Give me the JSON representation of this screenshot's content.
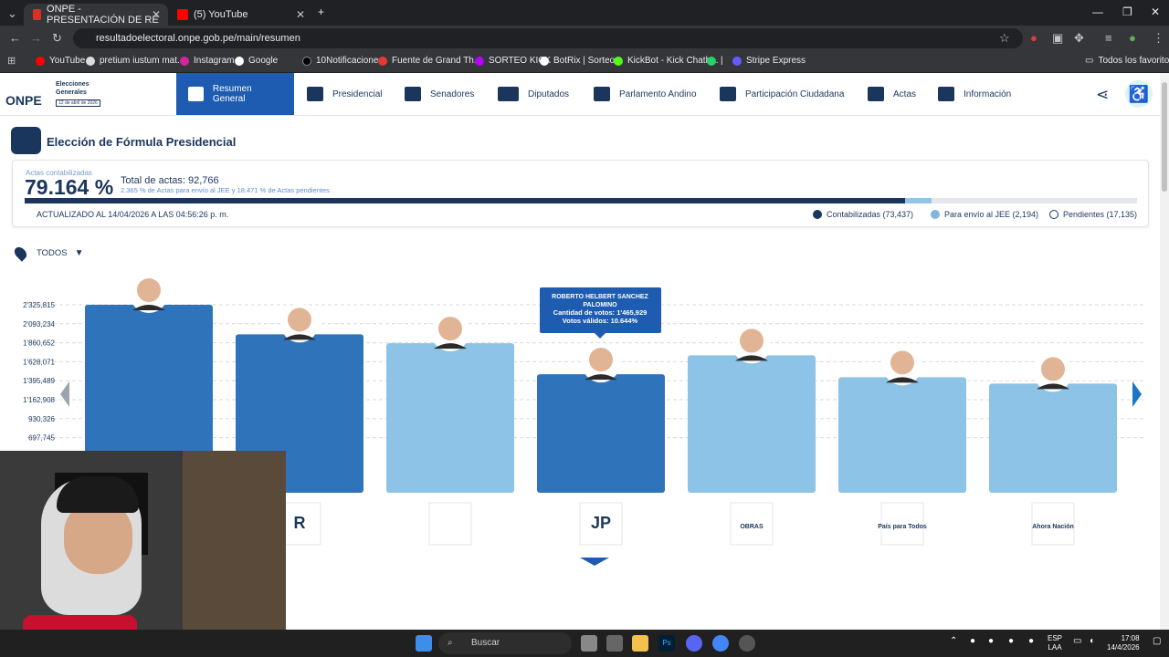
{
  "browser": {
    "tabs": [
      {
        "title": "ONPE - PRESENTACIÓN DE RE",
        "active": true
      },
      {
        "title": "(5) YouTube",
        "active": false
      }
    ],
    "url": "resultadoelectoral.onpe.gob.pe/main/resumen",
    "bookmarks": [
      "YouTube",
      "pretium iustum mat...",
      "Instagram",
      "Google",
      "10Notificaciones",
      "Fuente de Grand Th...",
      "SORTEO KICK",
      "BotRix | Sorteos",
      "KickBot - Kick Chatb...",
      "|",
      "Stripe Express"
    ],
    "bookmarks_folder": "Todos los favoritos"
  },
  "site": {
    "logo_text": "ONPE",
    "logo_title": "Elecciones Generales",
    "logo_date": "12 de abril de 2026",
    "nav": [
      "Resumen General",
      "Presidencial",
      "Senadores",
      "Diputados",
      "Parlamento Andino",
      "Participación Ciudadana",
      "Actas",
      "Información"
    ]
  },
  "page": {
    "title": "Elección de Fórmula Presidencial",
    "actas_label": "Actas contabilizadas",
    "actas_pct": "79.164 %",
    "total_actas": "Total de actas: 92,766",
    "subtitle": "2.365 % de Actas para envío al JEE y 18.471 % de Actas pendientes",
    "updated": "ACTUALIZADO AL 14/04/2026 A LAS 04:56:26 p. m.",
    "progress": {
      "contabilizadas": 0.79164,
      "jee": 0.02365
    },
    "legend": [
      {
        "label": "Contabilizadas (73,437)",
        "color": "#1b365d"
      },
      {
        "label": "Para envío al JEE (2,194)",
        "color": "#7fb5e0"
      },
      {
        "label": "Pendientes (17,135)",
        "color": "#ffffff"
      }
    ],
    "filter_label": "TODOS"
  },
  "tooltip": {
    "name": "ROBERTO HELBERT SANCHEZ PALOMINO",
    "votes": "Cantidad de votos: 1'465,929",
    "valid": "Votos válidos: 10.644%"
  },
  "chart_data": {
    "type": "bar",
    "y_ticks": [
      "2'325,815",
      "2'093,234",
      "1'860,652",
      "1'628,071",
      "1'395,489",
      "1'162,908",
      "930,326",
      "697,745"
    ],
    "ylim": [
      0,
      2325815
    ],
    "values": [
      2325815,
      1960000,
      1850000,
      1465929,
      1700000,
      1430000,
      1350000
    ],
    "party_labels": [
      "",
      "R",
      "",
      "JP",
      "OBRAS",
      "País para Todos",
      "Ahora Nación"
    ],
    "highlighted_index": 3,
    "bar_colors": [
      "#2f74bb",
      "#2f74bb",
      "#8cc3e6",
      "#2f74bb",
      "#8cc3e6",
      "#8cc3e6",
      "#8cc3e6"
    ]
  },
  "taskbar": {
    "search_label": "Buscar",
    "lang": "ESP",
    "lang2": "LAA",
    "time": "17:08",
    "date": "14/4/2026"
  }
}
